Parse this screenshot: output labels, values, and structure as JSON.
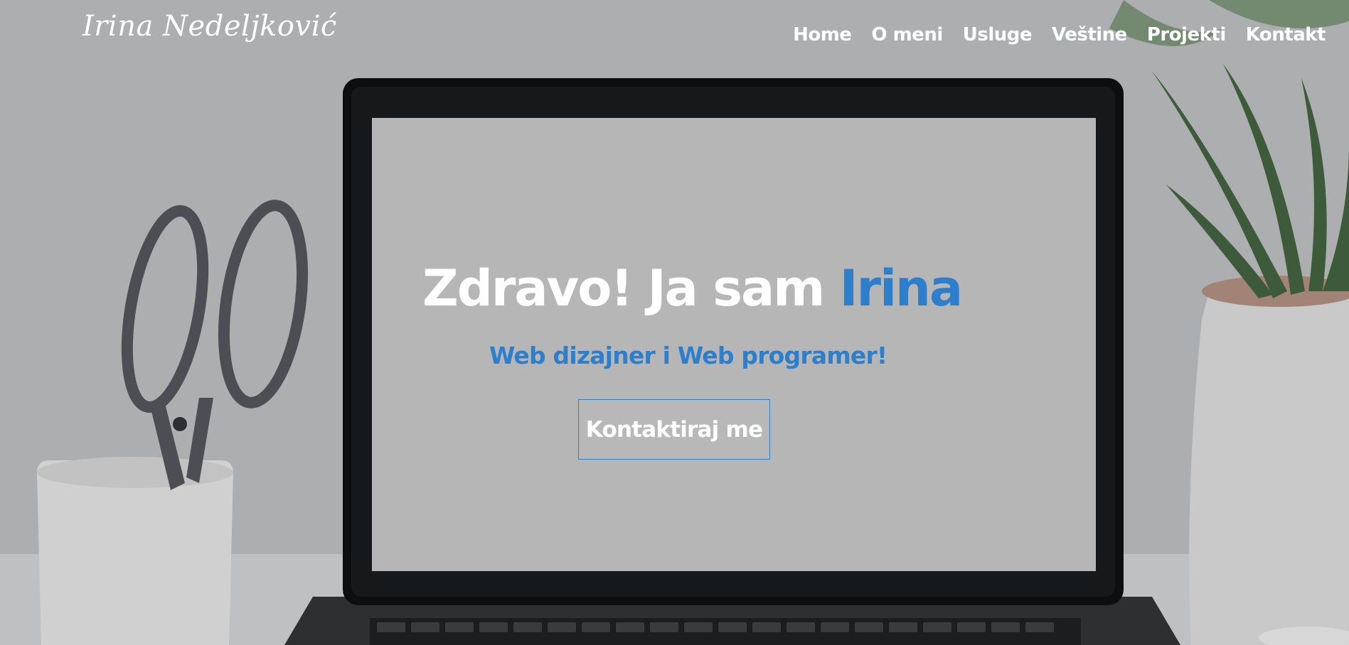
{
  "logo": {
    "text": "Irina Nedeljković"
  },
  "nav": {
    "items": [
      {
        "label": "Home"
      },
      {
        "label": "O meni"
      },
      {
        "label": "Usluge"
      },
      {
        "label": "Veštine"
      },
      {
        "label": "Projekti"
      },
      {
        "label": "Kontakt"
      }
    ]
  },
  "hero": {
    "title_prefix": "Zdravo! Ja sam ",
    "title_name": "Irina",
    "subtitle": "Web dizajner i Web programer!",
    "cta_label": "Kontaktiraj me",
    "background_scene": "laptop-desk-photo"
  },
  "colors": {
    "accent": "#2d7fcc",
    "text": "#ffffff",
    "overlay": "#a9aaac"
  }
}
